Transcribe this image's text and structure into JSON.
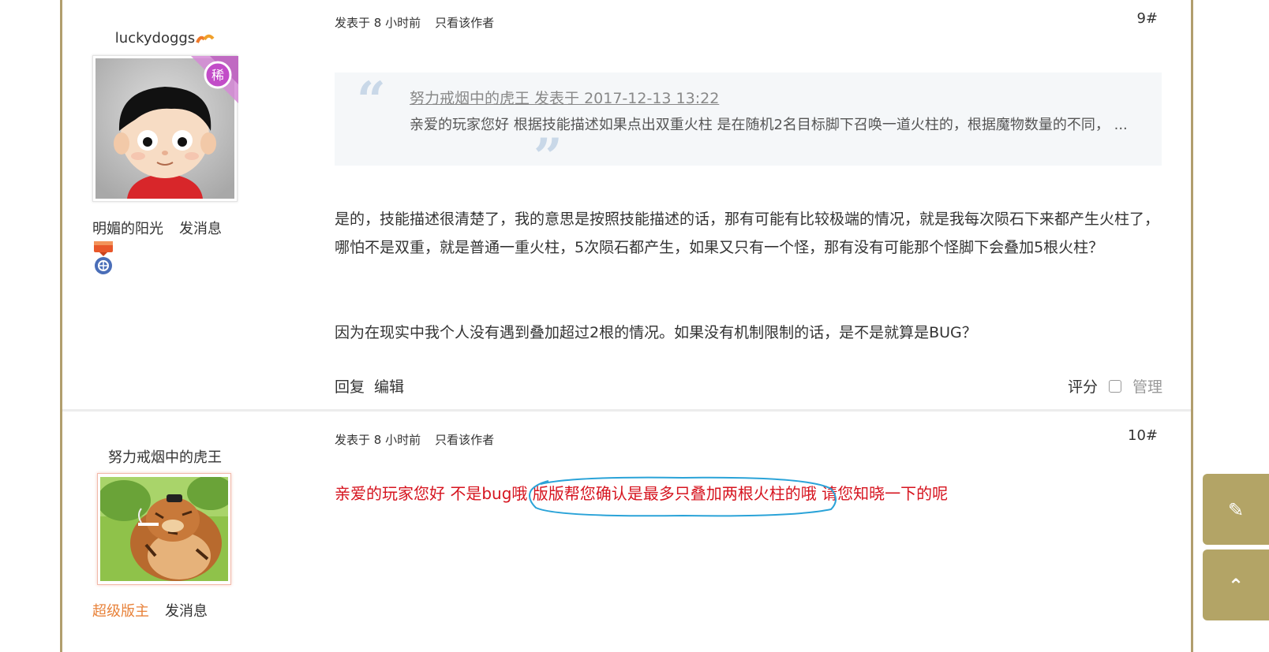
{
  "posts": [
    {
      "username": "luckydoggs",
      "user_links": [
        "明媚的阳光",
        "发消息"
      ],
      "meta": [
        "发表于 8 小时前",
        "只看该作者"
      ],
      "floor": "9#",
      "badge_rare": "稀",
      "quote": {
        "header": "努力戒烟中的虎王 发表于 2017-12-13 13:22",
        "text": "亲爱的玩家您好  根据技能描述如果点出双重火柱 是在随机2名目标脚下召唤一道火柱的，根据魔物数量的不同， ..."
      },
      "paragraph1": "是的，技能描述很清楚了，我的意思是按照技能描述的话，那有可能有比较极端的情况，就是我每次陨石下来都产生火柱了，哪怕不是双重，就是普通一重火柱，5次陨石都产生，如果又只有一个怪，那有没有可能那个怪脚下会叠加5根火柱？",
      "paragraph2": "因为在现实中我个人没有遇到叠加超过2根的情况。如果没有机制限制的话，是不是就算是BUG？",
      "actions": [
        "回复",
        "编辑"
      ],
      "rate_label": "评分",
      "admin_label": "管理"
    },
    {
      "username": "努力戒烟中的虎王",
      "role": "超级版主",
      "message_link": "发消息",
      "meta": [
        "发表于 8 小时前",
        "只看该作者"
      ],
      "floor": "10#",
      "reply_text": "亲爱的玩家您好 不是bug哦 版版帮您确认是最多只叠加两根火柱的哦 请您知晓一下的呢"
    }
  ],
  "colors": {
    "frame": "#b19e6d",
    "reply_red": "#d6141f",
    "circle_stroke": "#2aa3d8",
    "role_orange": "#e8823a",
    "side_button": "#b3a466"
  },
  "side_icons": [
    "edit-icon",
    "back-to-top-icon"
  ]
}
